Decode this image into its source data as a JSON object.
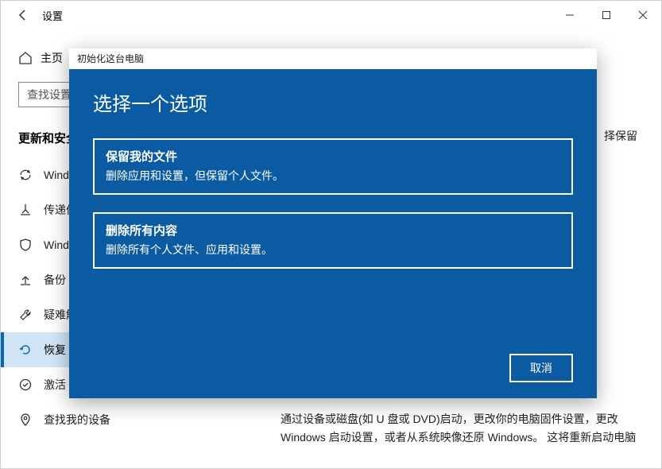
{
  "titlebar": {
    "title": "设置"
  },
  "sidebar": {
    "home": "主页",
    "search_placeholder": "查找设置",
    "section": "更新和安全",
    "items": [
      {
        "label": "Windows 更新",
        "icon": "sync"
      },
      {
        "label": "传递优化",
        "icon": "delivery"
      },
      {
        "label": "Windows 安全中心",
        "icon": "shield"
      },
      {
        "label": "备份",
        "icon": "backup"
      },
      {
        "label": "疑难解答",
        "icon": "troubleshoot"
      },
      {
        "label": "恢复",
        "icon": "recovery",
        "selected": true
      },
      {
        "label": "激活",
        "icon": "activate"
      },
      {
        "label": "查找我的设备",
        "icon": "find"
      }
    ]
  },
  "content": {
    "hint_right": "择保留",
    "bottom_text": "通过设备或磁盘(如 U 盘或 DVD)启动，更改你的电脑固件设置，更改 Windows 启动设置，或者从系统映像还原 Windows。 这将重新启动电脑"
  },
  "dialog": {
    "window_title": "初始化这台电脑",
    "title": "选择一个选项",
    "options": [
      {
        "title": "保留我的文件",
        "desc": "删除应用和设置，但保留个人文件。"
      },
      {
        "title": "删除所有内容",
        "desc": "删除所有个人文件、应用和设置。"
      }
    ],
    "cancel": "取消"
  }
}
